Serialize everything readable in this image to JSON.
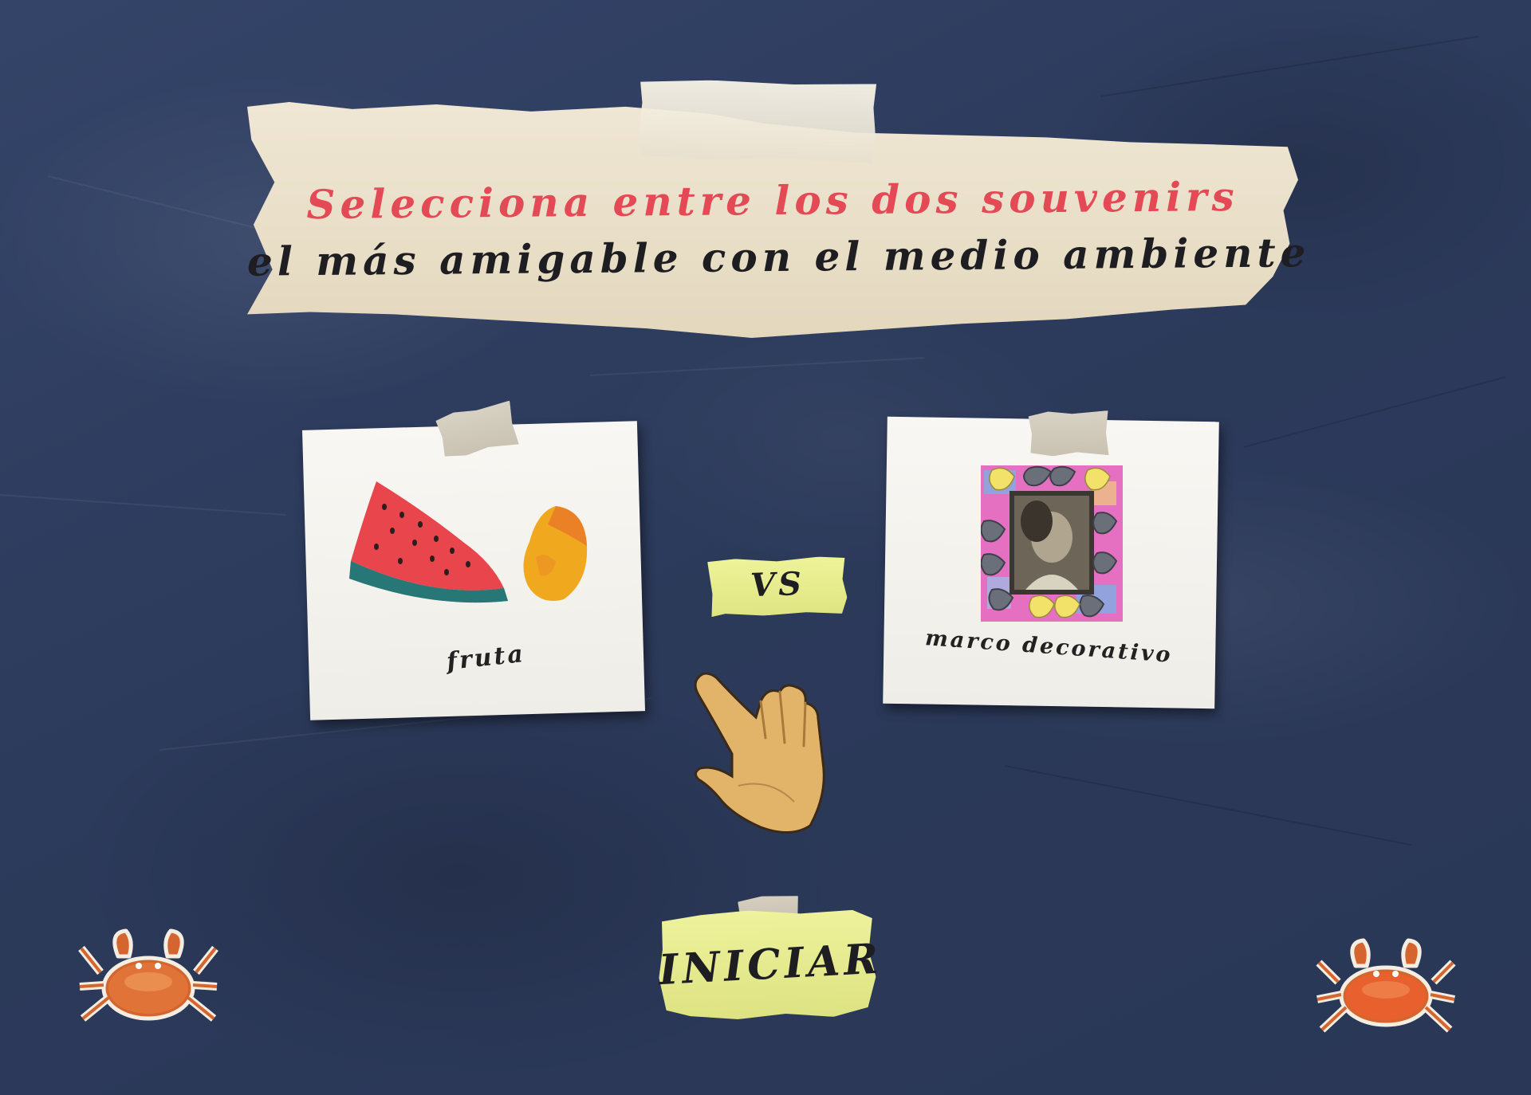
{
  "title": {
    "line1": "Selecciona entre los dos souvenirs",
    "line2": "el más amigable con el medio ambiente"
  },
  "options": [
    {
      "id": "left",
      "label": "fruta",
      "image": "watermelon-mango"
    },
    {
      "id": "right",
      "label": "marco decorativo",
      "image": "decorative-frame"
    }
  ],
  "versus_label": "VS",
  "start_button": {
    "label": "INICIAR"
  },
  "colors": {
    "background": "#2f3d5f",
    "title_accent": "#e34a56",
    "title_text": "#1e1e22",
    "card": "#f8f7f3",
    "label_paper": "#e9ee90",
    "tape": "#d8d2c4"
  },
  "icons": [
    "watermelon-icon",
    "mango-icon",
    "frame-icon",
    "hand-pointer-icon",
    "crab-icon"
  ]
}
